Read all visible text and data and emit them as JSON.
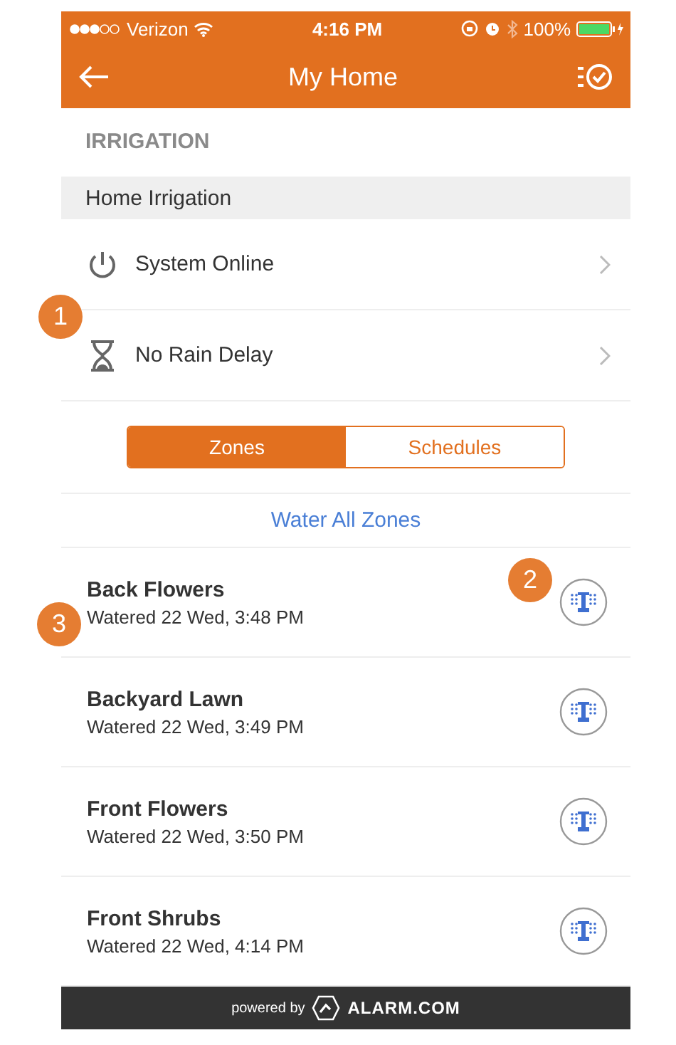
{
  "status_bar": {
    "carrier": "Verizon",
    "time": "4:16 PM",
    "battery": "100%"
  },
  "header": {
    "title": "My Home"
  },
  "section_title": "IRRIGATION",
  "group_title": "Home Irrigation",
  "status_rows": [
    {
      "kind": "power",
      "label": "System Online"
    },
    {
      "kind": "hourglass",
      "label": "No Rain Delay"
    }
  ],
  "segments": [
    {
      "label": "Zones",
      "selected": true
    },
    {
      "label": "Schedules",
      "selected": false
    }
  ],
  "water_all": "Water All Zones",
  "zones": [
    {
      "name": "Back Flowers",
      "watered": "Watered 22 Wed, 3:48 PM"
    },
    {
      "name": "Backyard Lawn",
      "watered": "Watered 22 Wed, 3:49 PM"
    },
    {
      "name": "Front Flowers",
      "watered": "Watered 22 Wed, 3:50 PM"
    },
    {
      "name": "Front Shrubs",
      "watered": "Watered 22 Wed, 4:14 PM"
    }
  ],
  "footer": {
    "prefix": "powered by",
    "brand": "ALARM.COM"
  },
  "callouts": [
    {
      "label": "1"
    },
    {
      "label": "2"
    },
    {
      "label": "3"
    }
  ]
}
